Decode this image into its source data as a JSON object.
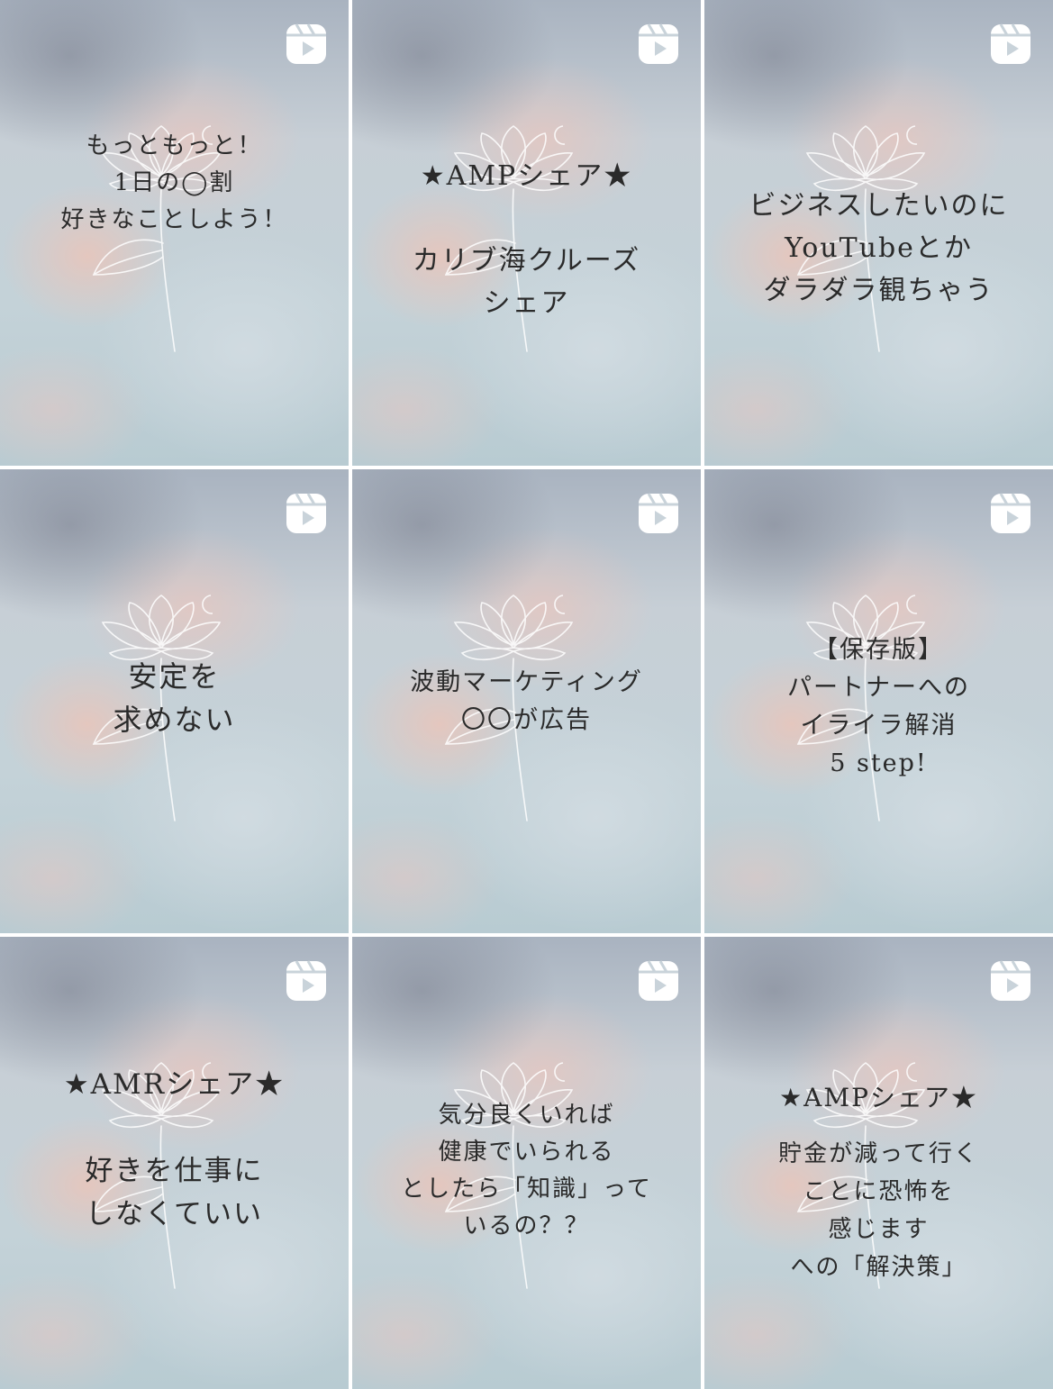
{
  "grid": {
    "tiles": [
      {
        "lines": [
          "もっともっと！",
          "1日の◯割",
          "好きなことしよう！"
        ]
      },
      {
        "lines": [
          "★AMPシェア★",
          "",
          "カリブ海クルーズ",
          "シェア"
        ]
      },
      {
        "lines": [
          "ビジネスしたいのに",
          "YouTubeとか",
          "ダラダラ観ちゃう"
        ]
      },
      {
        "lines": [
          "安定を",
          "求めない"
        ]
      },
      {
        "lines": [
          "波動マーケティング",
          "〇〇が広告"
        ]
      },
      {
        "lines": [
          "【保存版】",
          "パートナーへの",
          "イライラ解消",
          "5 step!"
        ]
      },
      {
        "lines": [
          "★AMRシェア★",
          "",
          "好きを仕事に",
          "しなくていい"
        ]
      },
      {
        "lines": [
          "気分良くいれば",
          "健康でいられる",
          "としたら「知識」って",
          "いるの？？"
        ]
      },
      {
        "lines": [
          "★AMPシェア★",
          "貯金が減って行く",
          "ことに恐怖を",
          "感じます",
          "への「解決策」"
        ]
      }
    ],
    "icon": "reels-icon",
    "decoration": "lotus-line-icon"
  }
}
